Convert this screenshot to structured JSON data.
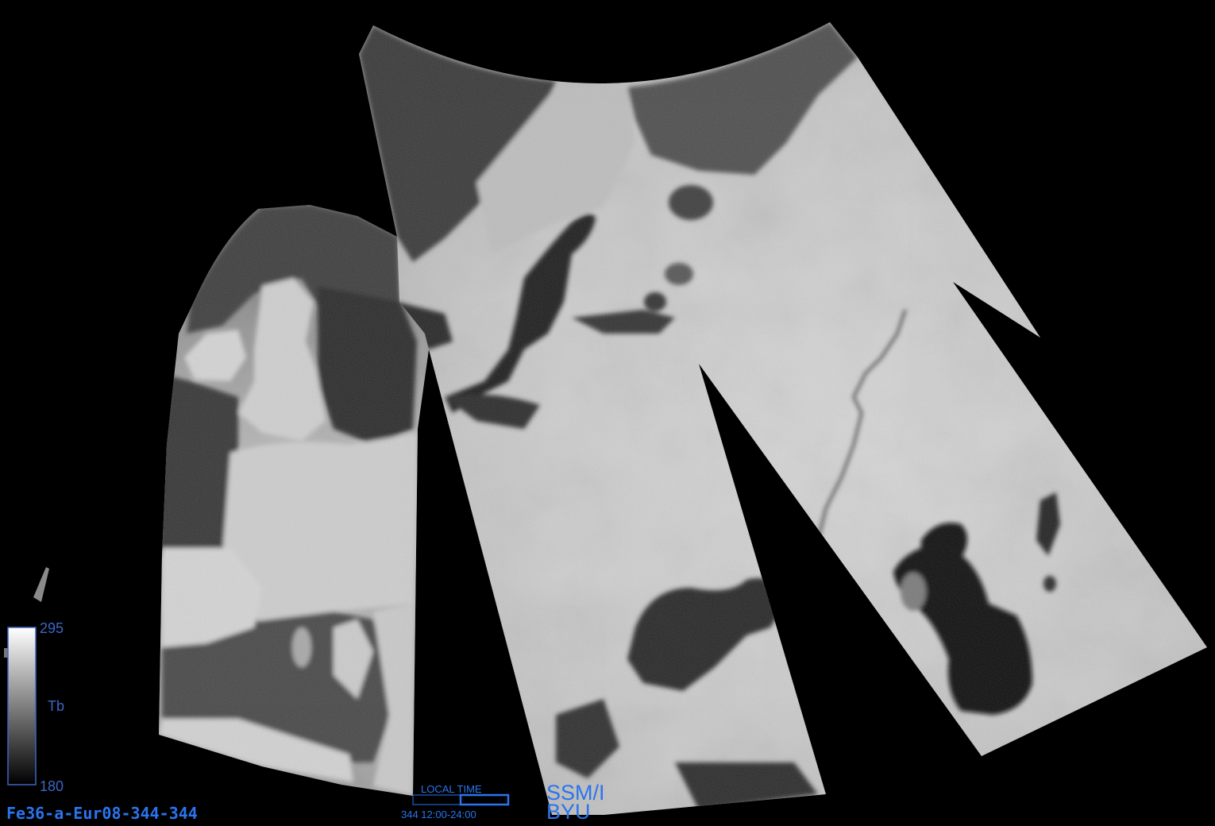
{
  "colorbar": {
    "max": "295",
    "label": "Tb",
    "min": "180",
    "top_color": "#ffffff",
    "bottom_color": "#000000"
  },
  "local_time": {
    "label": "LOCAL TIME",
    "range": "344 12:00-24:00"
  },
  "sensor": {
    "name": "SSM/I",
    "org": "BYU"
  },
  "product_name": "Fe36-a-Eur08-344-344",
  "colors": {
    "background": "#000000",
    "annotation": "#2a74ee",
    "annotation_muted": "#3b66c4"
  }
}
